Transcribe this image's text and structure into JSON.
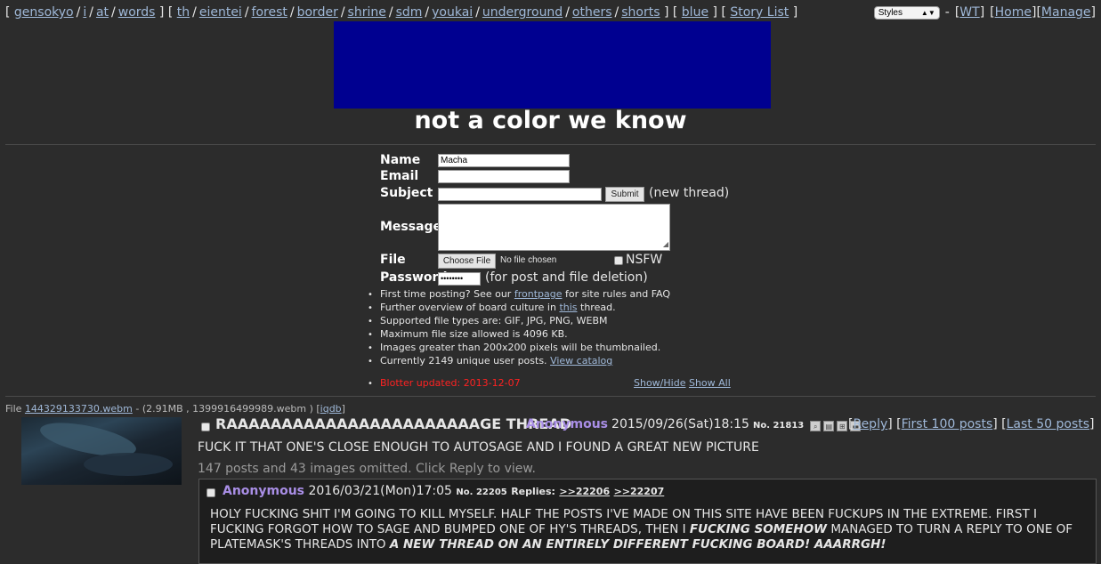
{
  "nav": {
    "boards_a": [
      "gensokyo",
      "i",
      "at",
      "words"
    ],
    "boards_b": [
      "th",
      "eientei",
      "forest",
      "border",
      "shrine",
      "sdm",
      "youkai",
      "underground",
      "others",
      "shorts"
    ],
    "boards_c": [
      "blue"
    ],
    "boards_d": [
      "Story List"
    ],
    "styles_label": "Styles",
    "right_links": [
      "WT",
      "Home",
      "Manage"
    ]
  },
  "board_title": "not a color we know",
  "form": {
    "name_label": "Name",
    "name_value": "Macha",
    "email_label": "Email",
    "subject_label": "Subject",
    "submit_label": "Submit",
    "new_thread_hint": "(new thread)",
    "message_label": "Message",
    "file_label": "File",
    "choose_file_label": "Choose File",
    "no_file_text": "No file chosen",
    "nsfw_label": "NSFW",
    "password_label": "Password",
    "password_value": "••••••••",
    "password_hint": "(for post and file deletion)"
  },
  "rules": {
    "r1_pre": "First time posting? See our ",
    "r1_link": "frontpage",
    "r1_post": " for site rules and FAQ",
    "r2_pre": "Further overview of board culture in ",
    "r2_link": "this",
    "r2_post": " thread.",
    "r3": "Supported file types are: GIF, JPG, PNG, WEBM",
    "r4": "Maximum file size allowed is 4096 KB.",
    "r5": "Images greater than 200x200 pixels will be thumbnailed.",
    "r6_pre": "Currently 2149 unique user posts. ",
    "r6_link": "View catalog"
  },
  "blotter": "Blotter updated: 2013-12-07",
  "show_hide": "Show/Hide",
  "show_all": "Show All",
  "thread": {
    "file_prefix": "File ",
    "file_name": "144329133730.webm",
    "file_meta": " - (2.91MB , 1399916499989.webm ) ",
    "iqdb": "iqdb",
    "subject": "RAAAAAAAAAAAAAAAAAAAAAAAGE THREAD",
    "author": "Anonymous",
    "time": "2015/09/26(Sat)18:15",
    "number": "No. 21813",
    "links": [
      "Reply",
      "First 100 posts",
      "Last 50 posts"
    ],
    "body": "FUCK IT THAT ONE'S CLOSE ENOUGH TO AUTOSAGE AND I FOUND A GREAT NEW PICTURE",
    "omitted": "147 posts and 43 images omitted. Click Reply to view."
  },
  "reply": {
    "author": "Anonymous",
    "time": "2016/03/21(Mon)17:05",
    "number": "No. 22205",
    "replies_label": "Replies:",
    "reply_links": [
      ">>22206",
      ">>22207"
    ],
    "body_1": "HOLY FUCKING SHIT I'M GOING TO KILL MYSELF. HALF THE POSTS I'VE MADE ON THIS SITE HAVE BEEN FUCKUPS IN THE EXTREME. FIRST I FUCKING FORGOT HOW TO SAGE AND BUMPED ONE OF HY'S THREADS, THEN I ",
    "body_em_1": "FUCKING SOMEHOW",
    "body_2": " MANAGED TO TURN A REPLY TO ONE OF PLATEMASK'S THREADS INTO ",
    "body_em_2": "A NEW THREAD ON AN ENTIRELY DIFFERENT FUCKING BOARD! AAARRGH!"
  }
}
